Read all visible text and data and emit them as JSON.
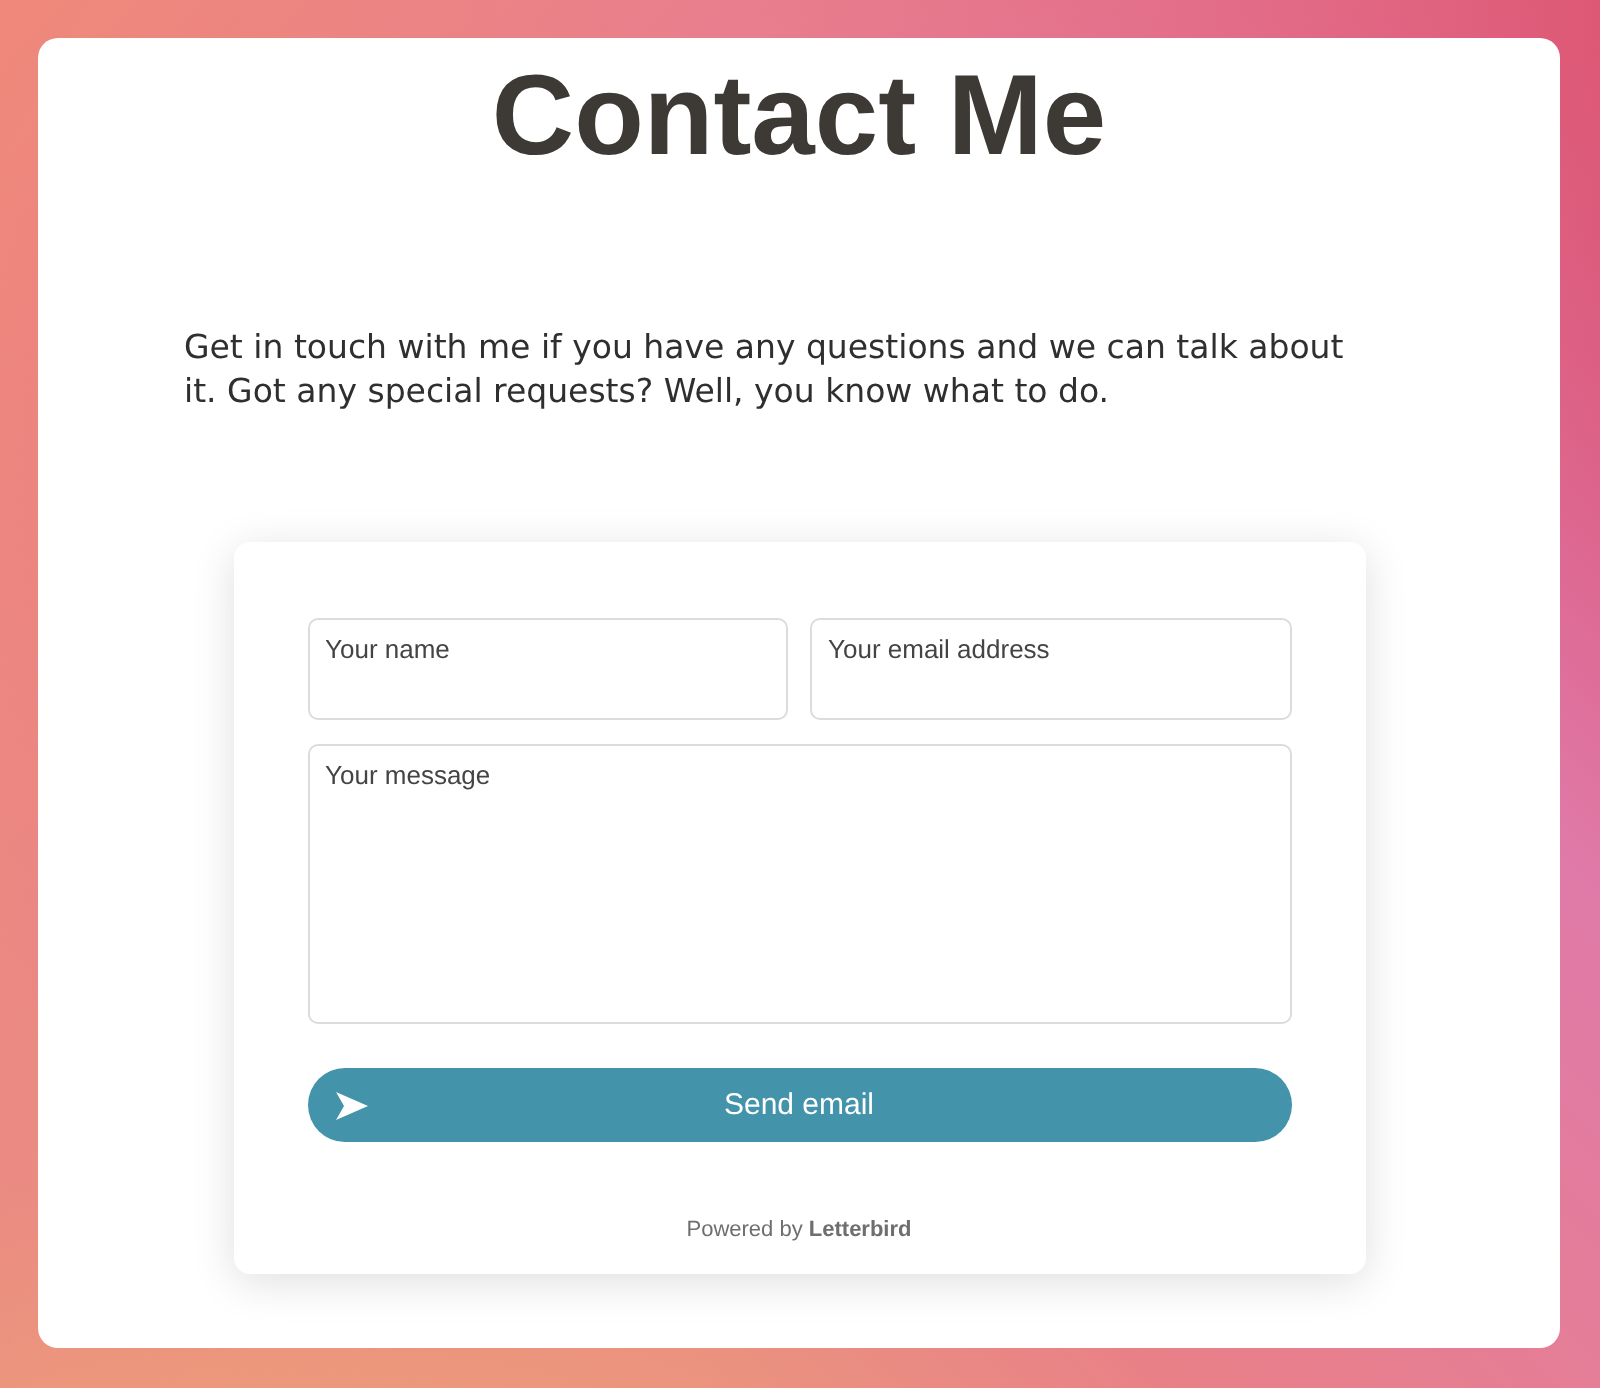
{
  "page": {
    "title": "Contact Me",
    "intro": "Get in touch with me if you have any questions and we can talk about it. Got any special requests? Well, you know what to do."
  },
  "form": {
    "fields": [
      {
        "kind": "line",
        "placeholder": "Your name"
      },
      {
        "kind": "line",
        "placeholder": "Your email address"
      },
      {
        "kind": "area",
        "placeholder": "Your message"
      }
    ],
    "button": {
      "label": "Send email"
    },
    "footer": "Powered by **Letterbird**"
  }
}
